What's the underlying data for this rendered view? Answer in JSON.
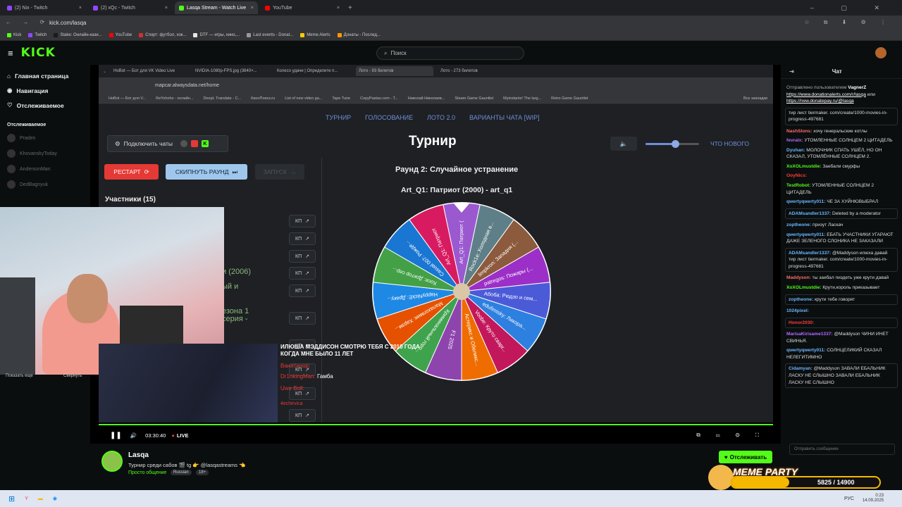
{
  "browser": {
    "tabs": [
      {
        "label": "(2) Nix - Twitch",
        "color": "#9146ff",
        "active": false
      },
      {
        "label": "(2) xQc - Twitch",
        "color": "#9146ff",
        "active": false
      },
      {
        "label": "Lasqa Stream - Watch Live",
        "color": "#53fc18",
        "active": true
      },
      {
        "label": "YouTube",
        "color": "#ff0000",
        "active": false
      }
    ],
    "url": "kick.com/lasqa",
    "bookmarks": [
      "Kick",
      "Twitch",
      "Stake: Онлайн-кази...",
      "YouTube",
      "Спорт: футбол, хок...",
      "DTF — игры, кино,...",
      "Last events - Donat...",
      "Meme Alerts",
      "Донаты - Послед..."
    ]
  },
  "kick": {
    "logo": "KICK",
    "search_placeholder": "Поиск",
    "nav": [
      {
        "label": "Главная страница",
        "icon": "home-icon"
      },
      {
        "label": "Навигация",
        "icon": "compass-icon"
      },
      {
        "label": "Отслеживаемое",
        "icon": "heart-icon"
      }
    ],
    "followed_title": "Отслеживаемое",
    "followed": [
      "Praden",
      "KhovanskyToday",
      "AndersonMan",
      "DedBagnyuk"
    ],
    "show_more": "Показать еще",
    "collapse": "Свернуть"
  },
  "inner_browser": {
    "tabs": [
      "HoBot — Бот для VK Video Live",
      "NVIDIA-1080p-FPS.jpg (3840×...",
      "Колесо удачи | Определите п...",
      "Лото - 93 билетов",
      "Лото - 273 билетов"
    ],
    "url": "mapcar.alwaysdata.net/home",
    "bookmarks": [
      "HoBot — Бот для V...",
      "ReYohoho - онлайн...",
      "DeepL Translate - C...",
      "КиноПоиск.ru",
      "List of new video ga...",
      "Tape Tune",
      "CopyPastas.com - T...",
      "Николай Николаев...",
      "Steam Game Gauntlet",
      "Myinstants! The larg...",
      "Retro Game Gauntlet"
    ],
    "all_bookmarks": "Все закладки"
  },
  "tournament": {
    "topnav": [
      "ТУРНИР",
      "ГОЛОСОВАНИЕ",
      "ЛОТО 2.0",
      "ВАРИАНТЫ ЧАТА [WIP]"
    ],
    "connect_chats": "Подключить чаты",
    "title": "Турнир",
    "whats_new": "ЧТО НОВОГО",
    "volume": 0.55,
    "restart": "РЕСТАРТ",
    "skip_round": "СКИПНУТЬ РАУНД",
    "launch": "ЗАПУСК",
    "participants": "Участники (15)",
    "kp_label": "КП",
    "partial_items": [
      "и (2006)",
      "ый и",
      "езона 1 серия -"
    ],
    "round": "Раунд 2: Случайное устранение",
    "current": "Art_Q1: Патриот (2000) - art_q1",
    "wheel": [
      {
        "label": "Art_Q1: Патриот (",
        "color": "#9b59d0"
      },
      {
        "label": "Rock1e: Холодная в...",
        "color": "#5e7f87"
      },
      {
        "label": "limpkron: Западня (...",
        "color": "#8c5a3c"
      },
      {
        "label": "patregos: Пожары (...",
        "color": "#9b2fc7"
      },
      {
        "label": "Абоба: Рюдзо и сем...",
        "color": "#4b5bd8"
      },
      {
        "label": "edufimisky: Ликора...",
        "color": "#2d7fe0"
      },
      {
        "label": "Voobe: Круто сварг...",
        "color": "#c2185b"
      },
      {
        "label": "Астерикс и Обеликс...",
        "color": "#ef6c00"
      },
      {
        "label": "F1 2025",
        "color": "#8e44ad"
      },
      {
        "label": "Криминальный горо...",
        "color": "#3fa34d"
      },
      {
        "label": "Малахолмия: Харзм...",
        "color": "#e65100"
      },
      {
        "label": "HappyNickE: Драку...",
        "color": "#1e88e5"
      },
      {
        "label": "Хосе: Доктор сер...",
        "color": "#43a047"
      },
      {
        "label": "Casual 007: Рожде...",
        "color": "#1976d2"
      },
      {
        "label": "Art_Q1: Патриот",
        "color": "#d81b60"
      }
    ]
  },
  "stream_chat_overlay": [
    {
      "user": "",
      "text": "ИЛЮША МЭДДИСОН СМОТРЮ ТЕБЯ С 2010 ГОДА КОГДА МНЕ БЫЛО 11 ЛЕТ"
    },
    {
      "user": "Ванятинор:",
      "text": ""
    },
    {
      "user": "Dr1nkingMan:",
      "text": "Гамба"
    },
    {
      "user": "Uwe Boll:",
      "text": ""
    },
    {
      "user": "4echevica",
      "text": ""
    }
  ],
  "player": {
    "time": "03:30:40",
    "live": "LIVE"
  },
  "streamer": {
    "name": "Lasqa",
    "title": "Турнир среди сабов 🎬 tg 👉 @lasqastreams 👈",
    "category": "Просто общение",
    "tags": [
      "Russian",
      "18+"
    ],
    "follow": "Отслеживать"
  },
  "chat": {
    "title": "Чат",
    "pinned_prefix": "Отправлено пользователем",
    "pinned_user": "VagnerZ",
    "pinned_links": [
      "https://www.donationalerts.com/r/lasqa",
      "https://new.donatepay.ru/@lasqa"
    ],
    "pinned_join": "или",
    "messages": [
      {
        "user": "",
        "color": "#ddd",
        "text": "тир лист tiermaker. com/create/1000-movies-in-progress-497681",
        "box": true
      },
      {
        "user": "NashSlons:",
        "color": "#ff6b6b",
        "text": "хочу генеральские котлы",
        "box": false
      },
      {
        "user": "fevralx:",
        "color": "#b26bff",
        "text": "УТОМЛЕННЫЕ СОЛНЦЕМ 2 ЦИТАДЕЛЬ",
        "box": false
      },
      {
        "user": "Dyuhan:",
        "color": "#6bb7ff",
        "text": "МОЛОЧНИК СПАТЬ УШЁЛ, НО ОН СКАЗАЛ, УТОМЛЁННЫЕ СОЛНЦЕМ 2.",
        "box": false
      },
      {
        "user": "XoXOLmustdie:",
        "color": "#53fc18",
        "text": "Заебали смурфы",
        "box": false
      },
      {
        "user": "OoyNics:",
        "color": "#ff3b3b",
        "text": "",
        "box": false
      },
      {
        "user": "TestRobot:",
        "color": "#53fc18",
        "text": "УТОМЛЕННЫЕ СОЛНЦЕМ 2 ЦИТАДЕЛЬ",
        "box": false
      },
      {
        "user": "qwertyqwerty011:",
        "color": "#6bb7ff",
        "text": "ЧЕ ЗА ХУЙНЮВЫБРАЛ",
        "box": false
      },
      {
        "user": "ADAMsandler1337:",
        "color": "#6bb7ff",
        "text": "Deleted by a moderator",
        "box": true
      },
      {
        "user": "zoptheone:",
        "color": "#6bb7ff",
        "text": "призут Ласкач",
        "box": false
      },
      {
        "user": "qwertyqwerty011:",
        "color": "#6bb7ff",
        "text": "ЕБАТЬ УЧАСТНИКИ УГАРАЮТ ДАЖЕ ЗЕЛЕНОГО СЛОНИКА НЕ ЗАКАЗАЛИ",
        "box": false
      },
      {
        "user": "ADAMsandler1337:",
        "color": "#6bb7ff",
        "text": "@Maddyson илюха давай тир лист tiermaker. com/create/1000-movies-in-progress-497681",
        "box": true
      },
      {
        "user": "Maddyson:",
        "color": "#ff6b6b",
        "text": "ты заебал пиздеть уже крути давай",
        "box": false
      },
      {
        "user": "XoXOLmustdie:",
        "color": "#53fc18",
        "text": "Крути,король приказывает",
        "box": false
      },
      {
        "user": "zoptheone:",
        "color": "#6bb7ff",
        "text": "крути тебе говорят",
        "box": true
      },
      {
        "user": "1024pixel:",
        "color": "#6bb7ff",
        "text": "",
        "box": false
      },
      {
        "user": "Honor2030:",
        "color": "#ff3b3b",
        "text": "",
        "box": true
      },
      {
        "user": "MarisaKirisame1337:",
        "color": "#b26bff",
        "text": "@Maddyson ЧИНИ ИНЕТ СВИНЬЯ.",
        "box": false
      },
      {
        "user": "qwertyqwerty011:",
        "color": "#6bb7ff",
        "text": "СОЛНЦЕЛИКИЙ СКАЗАЛ НЕЛЕГИТИМНО",
        "box": false
      },
      {
        "user": "Cidamyan:",
        "color": "#6bb7ff",
        "text": "@Maddyson ЗАВАЛИ ЕБАЛЬНИК ЛАСКУ НЕ СЛЫШНО ЗАВАЛИ ЕБАЛЬНИК ЛАСКУ НЕ СЛЫШНО",
        "box": true
      }
    ],
    "send_placeholder": "Отправить сообщение",
    "meme_party": "MEME PARTY",
    "meme_count": "5825 / 14900"
  },
  "taskbar": {
    "lang": "РУС",
    "time": "0:23",
    "date": "14.09.2025"
  }
}
